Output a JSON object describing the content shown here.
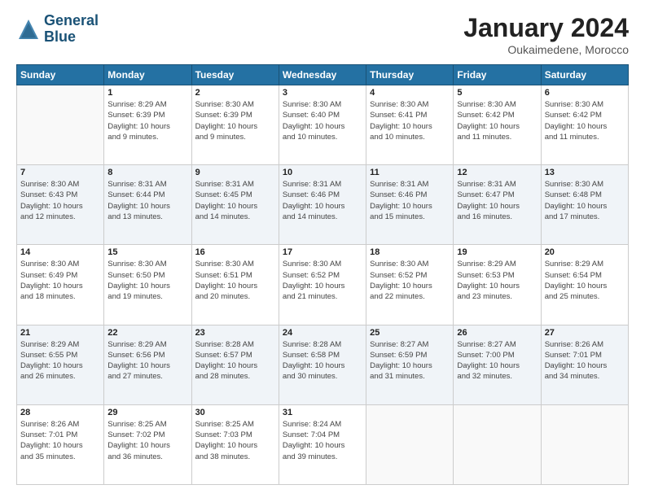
{
  "header": {
    "logo_line1": "General",
    "logo_line2": "Blue",
    "month_title": "January 2024",
    "subtitle": "Oukaimedene, Morocco"
  },
  "weekdays": [
    "Sunday",
    "Monday",
    "Tuesday",
    "Wednesday",
    "Thursday",
    "Friday",
    "Saturday"
  ],
  "weeks": [
    [
      {
        "day": "",
        "detail": ""
      },
      {
        "day": "1",
        "detail": "Sunrise: 8:29 AM\nSunset: 6:39 PM\nDaylight: 10 hours\nand 9 minutes."
      },
      {
        "day": "2",
        "detail": "Sunrise: 8:30 AM\nSunset: 6:39 PM\nDaylight: 10 hours\nand 9 minutes."
      },
      {
        "day": "3",
        "detail": "Sunrise: 8:30 AM\nSunset: 6:40 PM\nDaylight: 10 hours\nand 10 minutes."
      },
      {
        "day": "4",
        "detail": "Sunrise: 8:30 AM\nSunset: 6:41 PM\nDaylight: 10 hours\nand 10 minutes."
      },
      {
        "day": "5",
        "detail": "Sunrise: 8:30 AM\nSunset: 6:42 PM\nDaylight: 10 hours\nand 11 minutes."
      },
      {
        "day": "6",
        "detail": "Sunrise: 8:30 AM\nSunset: 6:42 PM\nDaylight: 10 hours\nand 11 minutes."
      }
    ],
    [
      {
        "day": "7",
        "detail": "Sunrise: 8:30 AM\nSunset: 6:43 PM\nDaylight: 10 hours\nand 12 minutes."
      },
      {
        "day": "8",
        "detail": "Sunrise: 8:31 AM\nSunset: 6:44 PM\nDaylight: 10 hours\nand 13 minutes."
      },
      {
        "day": "9",
        "detail": "Sunrise: 8:31 AM\nSunset: 6:45 PM\nDaylight: 10 hours\nand 14 minutes."
      },
      {
        "day": "10",
        "detail": "Sunrise: 8:31 AM\nSunset: 6:46 PM\nDaylight: 10 hours\nand 14 minutes."
      },
      {
        "day": "11",
        "detail": "Sunrise: 8:31 AM\nSunset: 6:46 PM\nDaylight: 10 hours\nand 15 minutes."
      },
      {
        "day": "12",
        "detail": "Sunrise: 8:31 AM\nSunset: 6:47 PM\nDaylight: 10 hours\nand 16 minutes."
      },
      {
        "day": "13",
        "detail": "Sunrise: 8:30 AM\nSunset: 6:48 PM\nDaylight: 10 hours\nand 17 minutes."
      }
    ],
    [
      {
        "day": "14",
        "detail": "Sunrise: 8:30 AM\nSunset: 6:49 PM\nDaylight: 10 hours\nand 18 minutes."
      },
      {
        "day": "15",
        "detail": "Sunrise: 8:30 AM\nSunset: 6:50 PM\nDaylight: 10 hours\nand 19 minutes."
      },
      {
        "day": "16",
        "detail": "Sunrise: 8:30 AM\nSunset: 6:51 PM\nDaylight: 10 hours\nand 20 minutes."
      },
      {
        "day": "17",
        "detail": "Sunrise: 8:30 AM\nSunset: 6:52 PM\nDaylight: 10 hours\nand 21 minutes."
      },
      {
        "day": "18",
        "detail": "Sunrise: 8:30 AM\nSunset: 6:52 PM\nDaylight: 10 hours\nand 22 minutes."
      },
      {
        "day": "19",
        "detail": "Sunrise: 8:29 AM\nSunset: 6:53 PM\nDaylight: 10 hours\nand 23 minutes."
      },
      {
        "day": "20",
        "detail": "Sunrise: 8:29 AM\nSunset: 6:54 PM\nDaylight: 10 hours\nand 25 minutes."
      }
    ],
    [
      {
        "day": "21",
        "detail": "Sunrise: 8:29 AM\nSunset: 6:55 PM\nDaylight: 10 hours\nand 26 minutes."
      },
      {
        "day": "22",
        "detail": "Sunrise: 8:29 AM\nSunset: 6:56 PM\nDaylight: 10 hours\nand 27 minutes."
      },
      {
        "day": "23",
        "detail": "Sunrise: 8:28 AM\nSunset: 6:57 PM\nDaylight: 10 hours\nand 28 minutes."
      },
      {
        "day": "24",
        "detail": "Sunrise: 8:28 AM\nSunset: 6:58 PM\nDaylight: 10 hours\nand 30 minutes."
      },
      {
        "day": "25",
        "detail": "Sunrise: 8:27 AM\nSunset: 6:59 PM\nDaylight: 10 hours\nand 31 minutes."
      },
      {
        "day": "26",
        "detail": "Sunrise: 8:27 AM\nSunset: 7:00 PM\nDaylight: 10 hours\nand 32 minutes."
      },
      {
        "day": "27",
        "detail": "Sunrise: 8:26 AM\nSunset: 7:01 PM\nDaylight: 10 hours\nand 34 minutes."
      }
    ],
    [
      {
        "day": "28",
        "detail": "Sunrise: 8:26 AM\nSunset: 7:01 PM\nDaylight: 10 hours\nand 35 minutes."
      },
      {
        "day": "29",
        "detail": "Sunrise: 8:25 AM\nSunset: 7:02 PM\nDaylight: 10 hours\nand 36 minutes."
      },
      {
        "day": "30",
        "detail": "Sunrise: 8:25 AM\nSunset: 7:03 PM\nDaylight: 10 hours\nand 38 minutes."
      },
      {
        "day": "31",
        "detail": "Sunrise: 8:24 AM\nSunset: 7:04 PM\nDaylight: 10 hours\nand 39 minutes."
      },
      {
        "day": "",
        "detail": ""
      },
      {
        "day": "",
        "detail": ""
      },
      {
        "day": "",
        "detail": ""
      }
    ]
  ]
}
